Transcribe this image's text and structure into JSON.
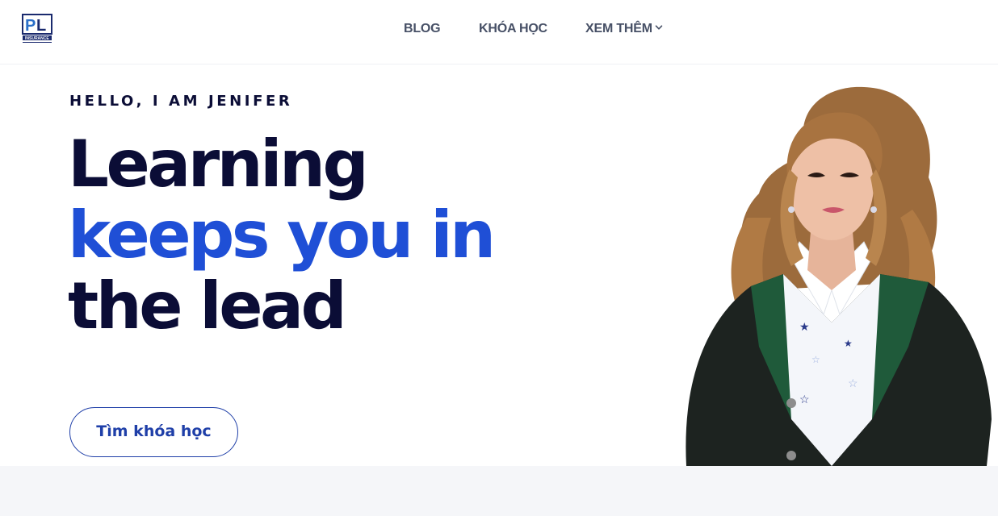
{
  "brand": {
    "logo_text": "PL",
    "logo_subtext": "INSURANCE",
    "colors": {
      "navy": "#0b0d36",
      "accent_blue": "#1f4fd6",
      "nav_text": "#475066"
    }
  },
  "nav": {
    "items": [
      {
        "label": "BLOG"
      },
      {
        "label": "KHÓA HỌC"
      },
      {
        "label": "XEM THÊM",
        "icon": "chevron-down-icon"
      }
    ]
  },
  "hero": {
    "eyebrow": "HELLO, I AM JENIFER",
    "headline": {
      "line1": "Learning",
      "line2": "keeps you in",
      "line3": "the lead"
    },
    "cta_label": "Tìm khóa học",
    "image": "portrait-photo"
  }
}
